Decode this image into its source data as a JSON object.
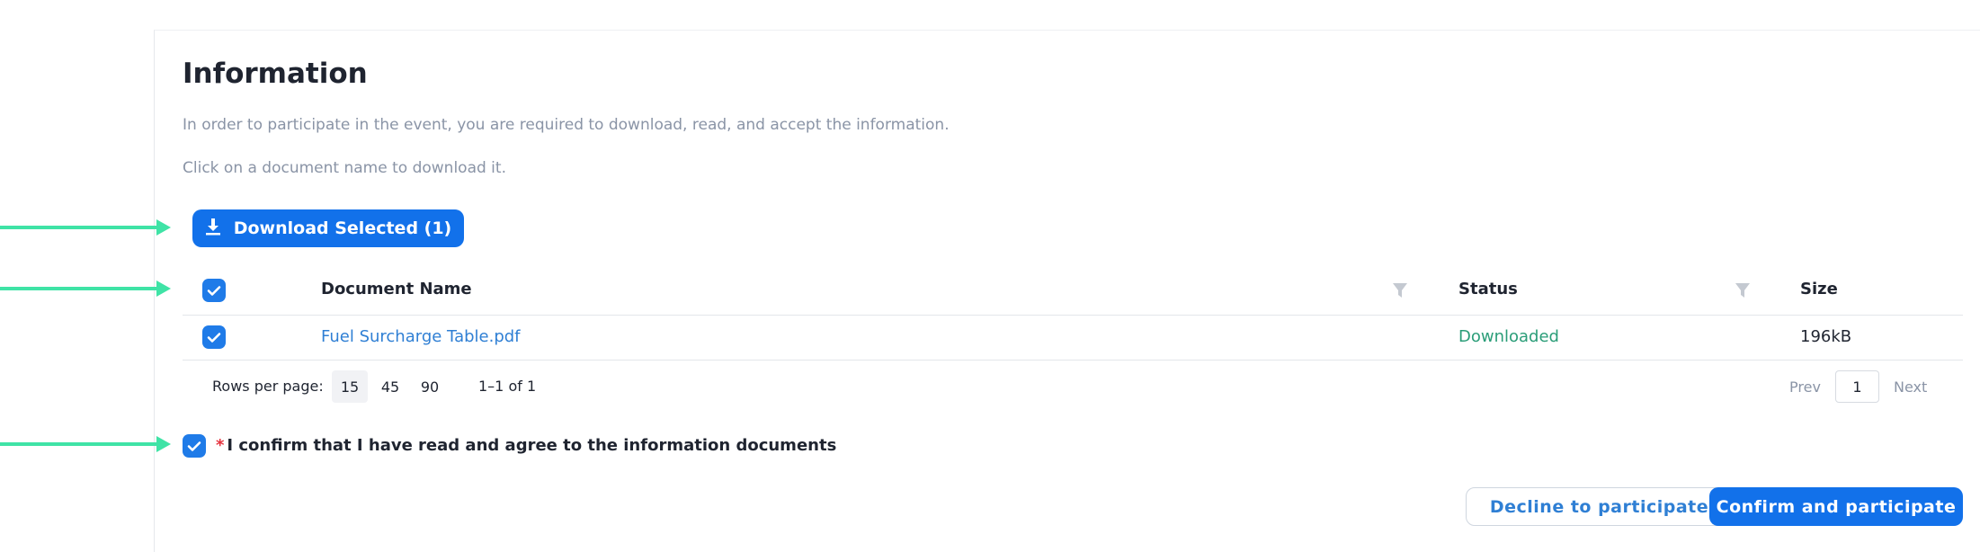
{
  "section": {
    "title": "Information",
    "description": "In order to participate in the event, you are required to download, read, and accept the information.",
    "hint": "Click on a document name to download it."
  },
  "toolbar": {
    "download_label": "Download Selected (1)",
    "download_icon": "download-icon"
  },
  "table": {
    "columns": [
      "Document Name",
      "Status",
      "Size"
    ],
    "rows": [
      {
        "selected": true,
        "name": "Fuel Surcharge Table.pdf",
        "status": "Downloaded",
        "size": "196kB"
      }
    ],
    "select_all": true
  },
  "pagination": {
    "rows_label": "Rows per page:",
    "options": [
      "15",
      "45",
      "90"
    ],
    "selected_option": "15",
    "range": "1–1 of 1",
    "prev": "Prev",
    "page": "1",
    "next": "Next"
  },
  "confirmation": {
    "required_mark": "*",
    "text": "I confirm that I have read and agree to the information documents",
    "checked": true
  },
  "actions": {
    "decline": "Decline to participate",
    "confirm": "Confirm and participate"
  },
  "colors": {
    "primary": "#1271ea",
    "link": "#2f7fd4",
    "success": "#2a9d78",
    "annotation_arrow": "#3fe3a6",
    "required": "#e5323e"
  }
}
